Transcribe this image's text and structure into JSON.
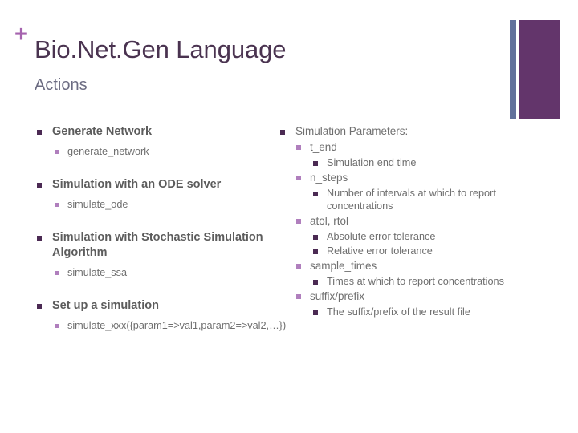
{
  "header": {
    "plus_icon": "plus-icon",
    "title": "Bio.Net.Gen Language",
    "subtitle": "Actions"
  },
  "colors": {
    "title": "#4a3350",
    "subtitle": "#6c6c82",
    "body": "#6f6f6f",
    "bullet_dark": "#4b2a53",
    "bullet_light": "#b07fbd",
    "deco_blue": "#61709b",
    "deco_purple": "#63356b",
    "plus": "#a563ae"
  },
  "left_column": [
    {
      "level": 1,
      "text": "Generate Network"
    },
    {
      "level": 2,
      "text": "generate_network"
    },
    {
      "level": 1,
      "text": "Simulation with an ODE solver"
    },
    {
      "level": 2,
      "text": "simulate_ode"
    },
    {
      "level": 1,
      "text": "Simulation with Stochastic Simulation Algorithm"
    },
    {
      "level": 2,
      "text": "simulate_ssa"
    },
    {
      "level": 1,
      "text": "Set up a simulation"
    },
    {
      "level": 2,
      "text": "simulate_xxx({param1=>val1,param2=>val2,…})"
    }
  ],
  "right_column": [
    {
      "level": 1,
      "text": "Simulation Parameters:"
    },
    {
      "level": 2,
      "text": "t_end"
    },
    {
      "level": 3,
      "text": "Simulation end time"
    },
    {
      "level": 2,
      "text": "n_steps"
    },
    {
      "level": 3,
      "text": "Number of intervals at which to report concentrations"
    },
    {
      "level": 2,
      "text": "atol, rtol"
    },
    {
      "level": 3,
      "text": "Absolute error tolerance"
    },
    {
      "level": 3,
      "text": "Relative error tolerance"
    },
    {
      "level": 2,
      "text": "sample_times"
    },
    {
      "level": 3,
      "text": "Times at which to report concentrations"
    },
    {
      "level": 2,
      "text": "suffix/prefix"
    },
    {
      "level": 3,
      "text": "The suffix/prefix of the result file"
    }
  ]
}
